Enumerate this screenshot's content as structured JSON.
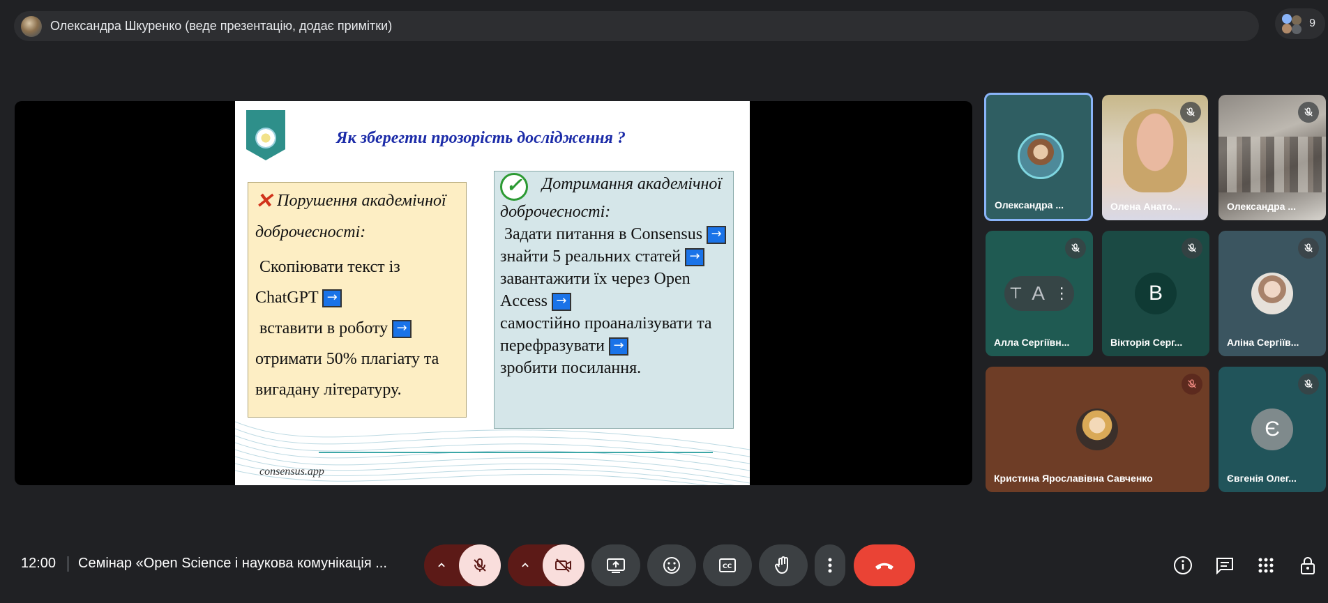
{
  "presenter": {
    "text": "Олександра Шкуренко (веде презентацію, додає примітки)",
    "people_count": "9"
  },
  "slide": {
    "title": "Як зберегти прозорість дослідження ?",
    "left_box": {
      "heading": "Порушення академічної доброчесності:",
      "line1": "Скопіювати текст із ChatGPT",
      "line2": "вставити в роботу",
      "line3": "отримати 50% плагіату та вигадану літературу."
    },
    "right_box": {
      "heading": "Дотримання академічної доброчесності:",
      "line1": "Задати питання в Consensus",
      "line2": "знайти 5 реальних статей",
      "line3": "завантажити їх через Open Access",
      "line4": "самостійно проаналізувати та перефразувати",
      "line5": "зробити посилання."
    },
    "arrow_glyph": "→",
    "footer": "consensus.app"
  },
  "participants": [
    {
      "name": "Олександра ...",
      "avatar": "photo",
      "muted": false
    },
    {
      "name": "Олена Анато...",
      "avatar": "video",
      "muted": true
    },
    {
      "name": "Олександра ...",
      "avatar": "video",
      "muted": true
    },
    {
      "name": "Алла Сергіївн...",
      "avatar": "А",
      "muted": true
    },
    {
      "name": "Вікторія Серг...",
      "avatar": "В",
      "muted": true
    },
    {
      "name": "Аліна Сергіїв...",
      "avatar": "photo",
      "muted": true
    },
    {
      "name": "Кристина Ярославівна Савченко",
      "avatar": "photo",
      "muted": true
    },
    {
      "name": "Євгенія Олег...",
      "avatar": "Є",
      "muted": true
    }
  ],
  "bottom_bar": {
    "time": "12:00",
    "meeting_title": "Семінар «Open Science і наукова комунікація ..."
  },
  "colors": {
    "background": "#202124",
    "leave_button": "#ea4335",
    "active_speaker_border": "#8ab4f8",
    "slide_title": "#1b2ba8"
  }
}
